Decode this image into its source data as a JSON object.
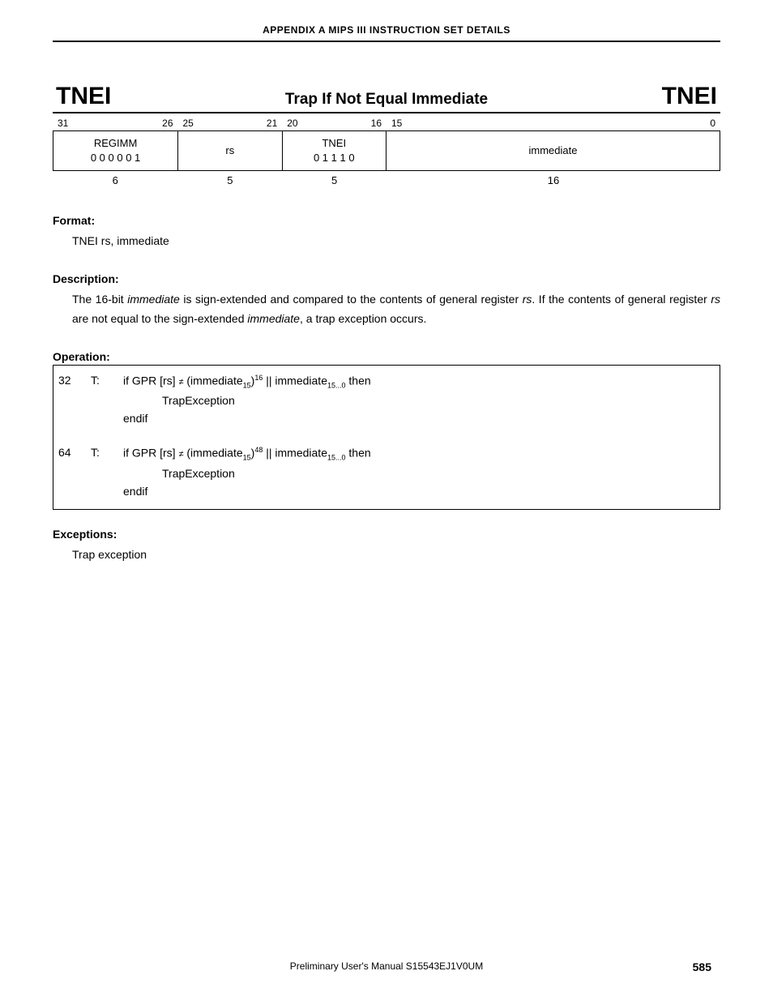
{
  "header": "APPENDIX A   MIPS III INSTRUCTION SET DETAILS",
  "title": {
    "left": "TNEI",
    "center": "Trap If Not Equal Immediate",
    "right": "TNEI"
  },
  "bits": {
    "f0": {
      "hi": "31",
      "lo": "26"
    },
    "f1": {
      "hi": "25",
      "lo": "21"
    },
    "f2": {
      "hi": "20",
      "lo": "16"
    },
    "f3": {
      "hi": "15",
      "lo": "0"
    }
  },
  "encoding": {
    "f0": {
      "name": "REGIMM",
      "val": "0 0 0 0 0 1"
    },
    "f1": {
      "name": "rs"
    },
    "f2": {
      "name": "TNEI",
      "val": "0 1 1 1 0"
    },
    "f3": {
      "name": "immediate"
    }
  },
  "widths": {
    "f0": "6",
    "f1": "5",
    "f2": "5",
    "f3": "16"
  },
  "format": {
    "heading": "Format:",
    "text": "TNEI rs, immediate"
  },
  "description": {
    "heading": "Description:",
    "p1a": "The 16-bit ",
    "p1b": "immediate",
    "p1c": " is sign-extended and compared to the contents of general register ",
    "p1d": "rs",
    "p1e": ".  If the contents of general register ",
    "p1f": "rs",
    "p1g": " are not equal to the sign-extended ",
    "p1h": "immediate",
    "p1i": ", a trap exception occurs."
  },
  "operation": {
    "heading": "Operation:",
    "r32": {
      "mode": "32",
      "t": "T:",
      "l1a": "if GPR [rs] ",
      "l1b": " (immediate",
      "l1c": ")",
      "sup1": "16",
      "l1d": " || immediate",
      "l1e": " then",
      "sub1": "15",
      "sub2": "15...0",
      "l2": "TrapException",
      "l3": "endif"
    },
    "r64": {
      "mode": "64",
      "t": "T:",
      "l1a": "if GPR [rs] ",
      "l1b": " (immediate",
      "l1c": ")",
      "sup1": "48",
      "l1d": " || immediate",
      "l1e": " then",
      "sub1": "15",
      "sub2": "15...0",
      "l2": "TrapException",
      "l3": "endif"
    }
  },
  "exceptions": {
    "heading": "Exceptions:",
    "text": "Trap exception"
  },
  "footer": {
    "text": "Preliminary User's Manual  S15543EJ1V0UM",
    "page": "585"
  }
}
